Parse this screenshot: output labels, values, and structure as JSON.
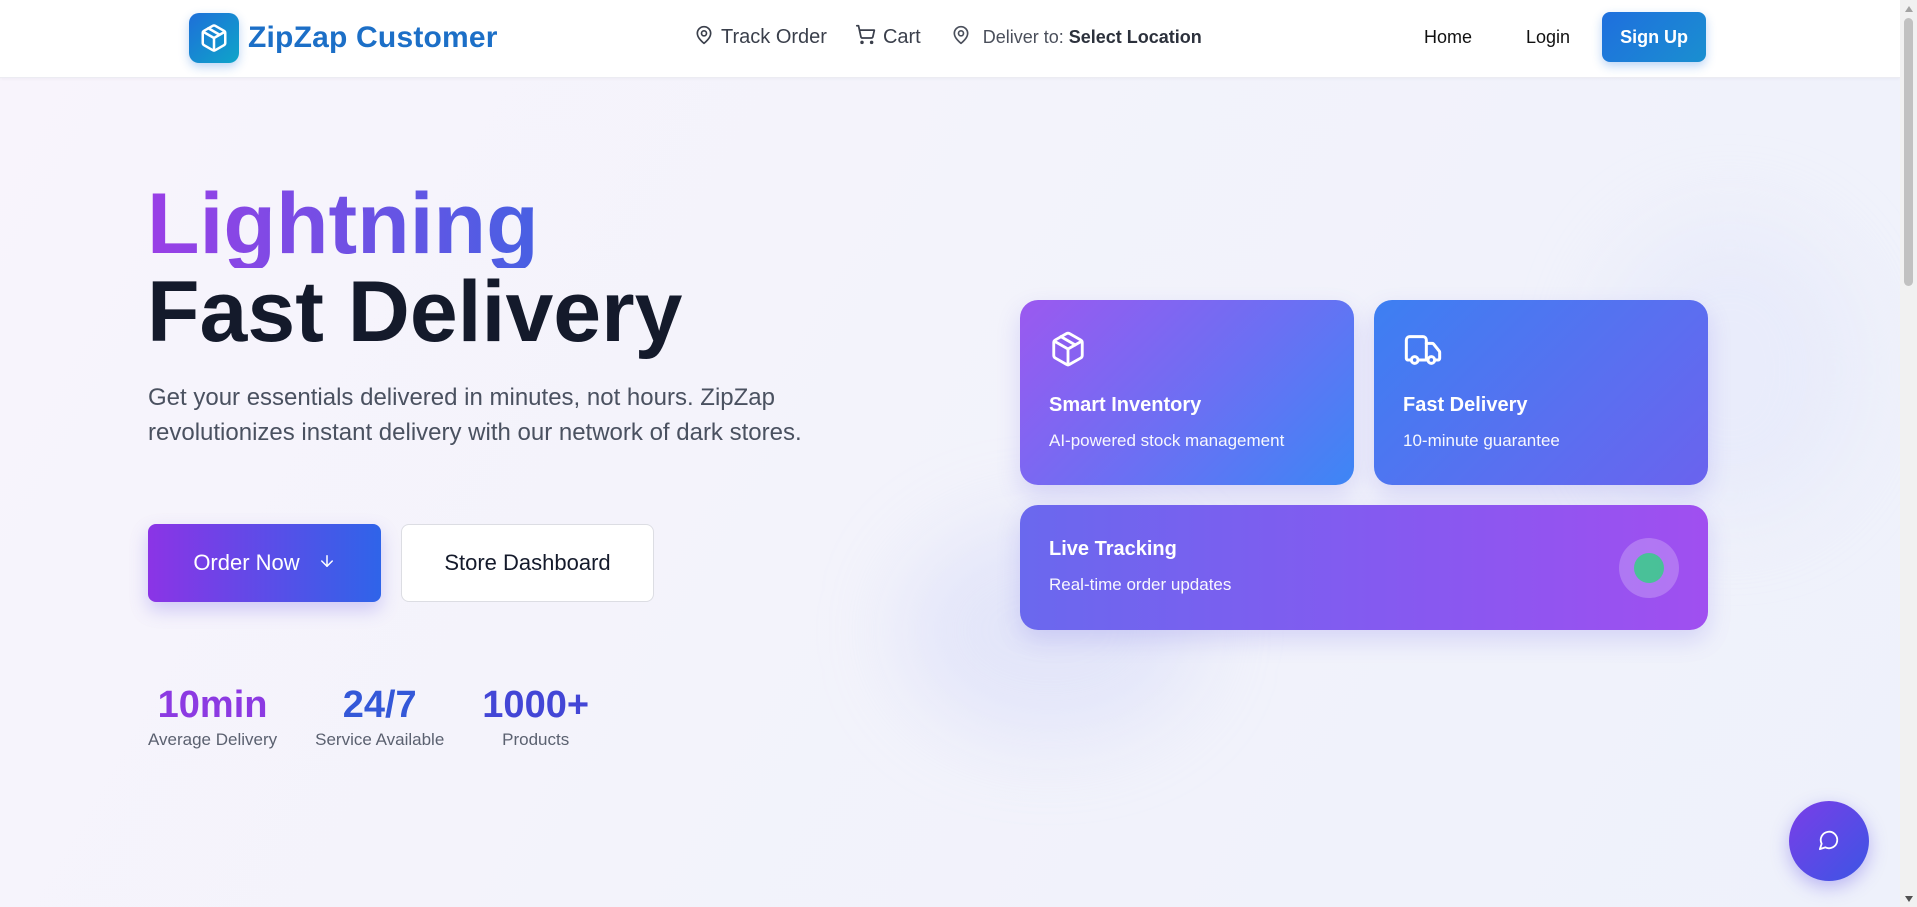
{
  "navbar": {
    "brand": "ZipZap Customer",
    "track_order": "Track Order",
    "cart": "Cart",
    "deliver_prefix": "Deliver to:",
    "deliver_location": "Select Location",
    "home": "Home",
    "login": "Login",
    "signup": "Sign Up"
  },
  "hero": {
    "title_line1": "Lightning",
    "title_line2": "Fast Delivery",
    "description": "Get your essentials delivered in minutes, not hours. ZipZap revolutionizes instant delivery with our network of dark stores.",
    "order_button": "Order Now",
    "dashboard_button": "Store Dashboard",
    "stats": [
      {
        "value": "10min",
        "label": "Average Delivery"
      },
      {
        "value": "24/7",
        "label": "Service Available"
      },
      {
        "value": "1000+",
        "label": "Products"
      }
    ]
  },
  "features": {
    "inventory": {
      "title": "Smart Inventory",
      "subtitle": "AI-powered stock management",
      "icon": "package-icon"
    },
    "delivery": {
      "title": "Fast Delivery",
      "subtitle": "10-minute guarantee",
      "icon": "truck-icon"
    },
    "tracking": {
      "title": "Live Tracking",
      "subtitle": "Real-time order updates",
      "indicator_color": "#3ec98e"
    }
  },
  "colors": {
    "brand": "#1c6fc7",
    "accent_purple": "#8b34e6",
    "accent_blue": "#2f64e9"
  },
  "icons": {
    "logo": "package-icon",
    "track": "map-pin-icon",
    "cart": "shopping-cart-icon",
    "location": "map-pin-icon",
    "order_arrow": "arrow-down-icon",
    "chat": "message-circle-icon"
  }
}
